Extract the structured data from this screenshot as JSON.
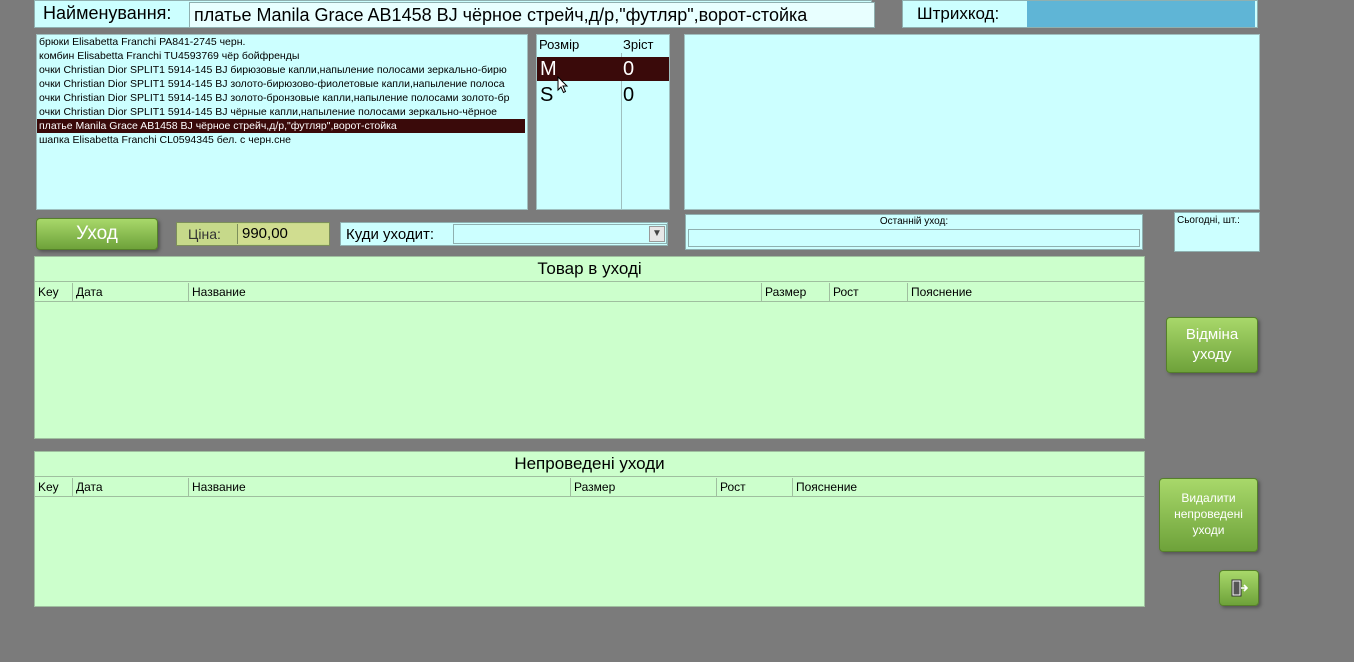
{
  "header": {
    "name_label": "Найменування:",
    "name_value": "платье Manila Grace AB1458 BJ чёрное стрейч,д/р,\"футляр\",ворот-стойка",
    "barcode_label": "Штрихкод:",
    "barcode_value": ""
  },
  "products": [
    "брюки Elisabetta Franchi PA841-2745 черн.",
    "комбин Elisabetta Franchi TU4593769 чёр бойфренды",
    "очки Christian Dior SPLIT1 5914-145 BJ бирюзовые капли,напыление полосами зеркально-бирю",
    "очки Christian Dior SPLIT1 5914-145 BJ золото-бирюзово-фиолетовые капли,напыление полоса",
    "очки Christian Dior SPLIT1 5914-145 BJ золото-бронзовые капли,напыление полосами золото-бр",
    "очки Christian Dior SPLIT1 5914-145 BJ чёрные капли,напыление полосами зеркально-чёрное",
    "платье Manila Grace AB1458 BJ чёрное стрейч,д/р,\"футляр\",ворот-стойка",
    "шапка Elisabetta Franchi CL0594345 бел. с черн.сне"
  ],
  "sizes": {
    "header_size": "Розмір",
    "header_height": "Зріст",
    "rows": [
      {
        "size": "M",
        "height": "0"
      },
      {
        "size": "S",
        "height": "0"
      }
    ]
  },
  "actions": {
    "out_button": "Уход",
    "price_label": "Ціна:",
    "price_value": "990,00",
    "destination_label": "Куди уходит:",
    "destination_value": "",
    "last_out_label": "Останній уход:",
    "today_label": "Сьогодні, шт.:"
  },
  "panel_out": {
    "title": "Товар в уході",
    "columns": [
      "Key",
      "Дата",
      "Название",
      "Размер",
      "Рост",
      "Пояснение"
    ]
  },
  "panel_pending": {
    "title": "Непроведені уходи",
    "columns": [
      "Key",
      "Дата",
      "Название",
      "Размер",
      "Рост",
      "Пояснение"
    ]
  },
  "side_buttons": {
    "cancel_line1": "Відміна",
    "cancel_line2": "уходу",
    "delete_line1": "Видалити",
    "delete_line2": "непроведені",
    "delete_line3": "уходи",
    "exit_icon": "exit-door-icon"
  },
  "colors": {
    "background": "#7b7b7b",
    "cyan_field": "#ccffff",
    "green_panel": "#ccffcc",
    "selection": "#3a0a0a",
    "button_green": "#8cc04e",
    "barcode_field": "#5fb5d6"
  }
}
